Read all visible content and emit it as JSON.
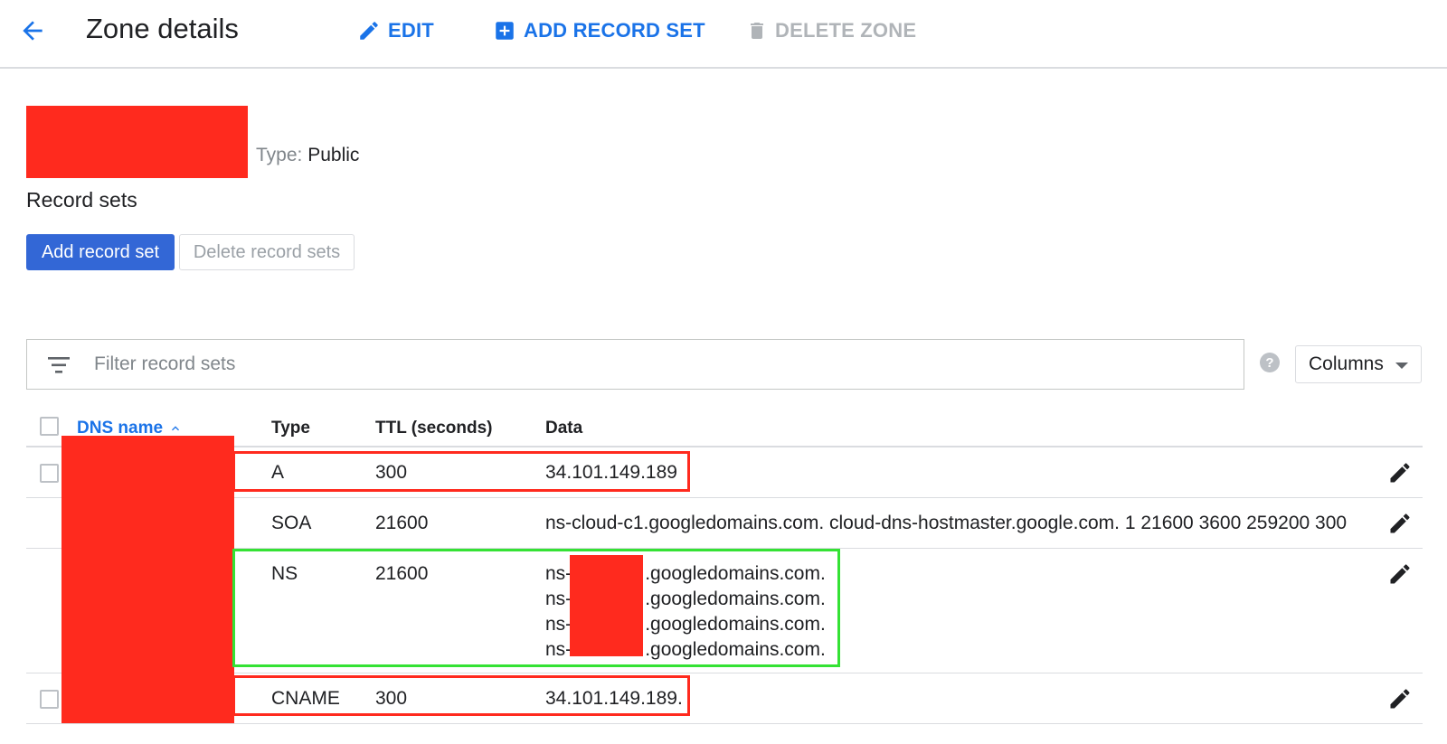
{
  "toolbar": {
    "title": "Zone details",
    "edit_label": "EDIT",
    "add_record_set_label": "ADD RECORD SET",
    "delete_zone_label": "DELETE ZONE",
    "accent_color": "#1a73e8",
    "disabled_color": "#b0b4b8"
  },
  "zone": {
    "type_key": "Type:",
    "type_value": "Public"
  },
  "record_sets": {
    "title": "Record sets",
    "add_button": "Add record set",
    "delete_button": "Delete record sets",
    "primary_button_color": "#3367d6"
  },
  "filter": {
    "placeholder": "Filter record sets",
    "help_label": "?",
    "columns_label": "Columns"
  },
  "table": {
    "headers": {
      "dns_name": "DNS name",
      "type": "Type",
      "ttl": "TTL (seconds)",
      "data": "Data"
    },
    "sort": {
      "column": "DNS name",
      "direction": "ascending"
    },
    "rows": [
      {
        "type": "A",
        "ttl": "300",
        "data": "34.101.149.189"
      },
      {
        "type": "SOA",
        "ttl": "21600",
        "data": "ns-cloud-c1.googledomains.com. cloud-dns-hostmaster.google.com. 1 21600 3600 259200 300"
      },
      {
        "type": "NS",
        "ttl": "21600",
        "data_prefix": "ns-",
        "data_suffix": ".googledomains.com.",
        "data_lines": [
          "ns-",
          "ns-",
          "ns-",
          "ns-"
        ]
      },
      {
        "type": "CNAME",
        "ttl": "300",
        "data": "34.101.149.189."
      }
    ]
  },
  "annotations": {
    "redaction_color": "#ff2a1e",
    "red_box_color": "#ff2a1e",
    "green_box_color": "#34e234"
  }
}
